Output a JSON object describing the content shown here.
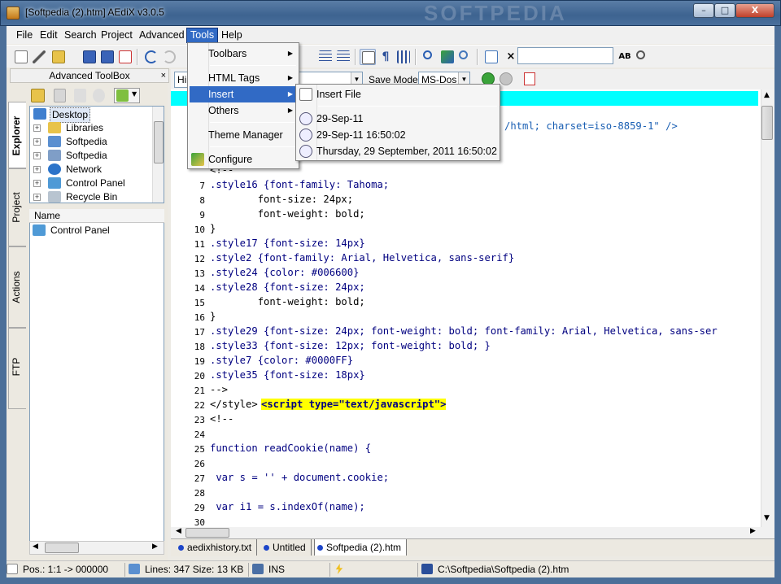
{
  "window": {
    "title": "[Softpedia (2).htm] AEdiX v3.0.5",
    "watermark": "SOFTPEDIA",
    "min": "–",
    "max": "□",
    "close": "X"
  },
  "menubar": [
    "File",
    "Edit",
    "Search",
    "Project",
    "Advanced",
    "Tools",
    "Help"
  ],
  "toolbar": {
    "search_value": "",
    "label_ab": "AB"
  },
  "toolbox": {
    "title": "Advanced ToolBox",
    "close": "×",
    "tabs": [
      "Explorer",
      "Project",
      "Actions",
      "FTP"
    ],
    "tree": [
      "Desktop",
      "Libraries",
      "Softpedia",
      "Softpedia",
      "Network",
      "Control Panel",
      "Recycle Bin"
    ],
    "list_header": "Name",
    "list_items": [
      "Control Panel"
    ]
  },
  "editor_toolbar": {
    "hi_label": "Hi",
    "save_mode_label": "Save Mode:",
    "save_mode_value": "MS-Dos"
  },
  "tools_menu": {
    "items": [
      "Toolbars",
      "HTML Tags",
      "Insert",
      "Others",
      "Theme Manager",
      "Configure"
    ],
    "highlighted": "Insert"
  },
  "insert_submenu": {
    "items": [
      "Insert File",
      "29-Sep-11",
      "29-Sep-11 16:50:02",
      "Thursday, 29 September, 2011 16:50:02"
    ]
  },
  "editor": {
    "line1_fragment": "/html; charset=iso-8859-1\" />",
    "lines": [
      {
        "n": "",
        "t": "<!--"
      },
      {
        "n": "7",
        "t": ".style16 {font-family: Tahoma;"
      },
      {
        "n": "8",
        "t": "        font-size: 24px;"
      },
      {
        "n": "9",
        "t": "        font-weight: bold;"
      },
      {
        "n": "10",
        "t": "}"
      },
      {
        "n": "11",
        "t": ".style17 {font-size: 14px}"
      },
      {
        "n": "12",
        "t": ".style2 {font-family: Arial, Helvetica, sans-serif}"
      },
      {
        "n": "13",
        "t": ".style24 {color: #006600}"
      },
      {
        "n": "14",
        "t": ".style28 {font-size: 24px;"
      },
      {
        "n": "15",
        "t": "        font-weight: bold;"
      },
      {
        "n": "16",
        "t": "}"
      },
      {
        "n": "17",
        "t": ".style29 {font-size: 24px; font-weight: bold; font-family: Arial, Helvetica, sans-ser"
      },
      {
        "n": "18",
        "t": ".style33 {font-size: 12px; font-weight: bold; }"
      },
      {
        "n": "19",
        "t": ".style7 {color: #0000FF}"
      },
      {
        "n": "20",
        "t": ".style35 {font-size: 18px}"
      },
      {
        "n": "21",
        "t": "-->"
      },
      {
        "n": "22",
        "t_a": "</style>",
        "t_b": "<script type=\"text/javascript\">"
      },
      {
        "n": "23",
        "t": "<!--"
      },
      {
        "n": "24",
        "t": ""
      },
      {
        "n": "25",
        "t": "function readCookie(name) {"
      },
      {
        "n": "26",
        "t": ""
      },
      {
        "n": "27",
        "t": " var s = '' + document.cookie;"
      },
      {
        "n": "28",
        "t": ""
      },
      {
        "n": "29",
        "t": " var i1 = s.indexOf(name);"
      },
      {
        "n": "30",
        "t": ""
      }
    ]
  },
  "doc_tabs": [
    "aedixhistory.txt",
    "Untitled",
    "Softpedia (2).htm"
  ],
  "statusbar": {
    "pos": "Pos.: 1:1 -> 000000",
    "lines": "Lines: 347 Size: 13 KB",
    "mode": "INS",
    "path": "C:\\Softpedia\\Softpedia (2).htm"
  }
}
